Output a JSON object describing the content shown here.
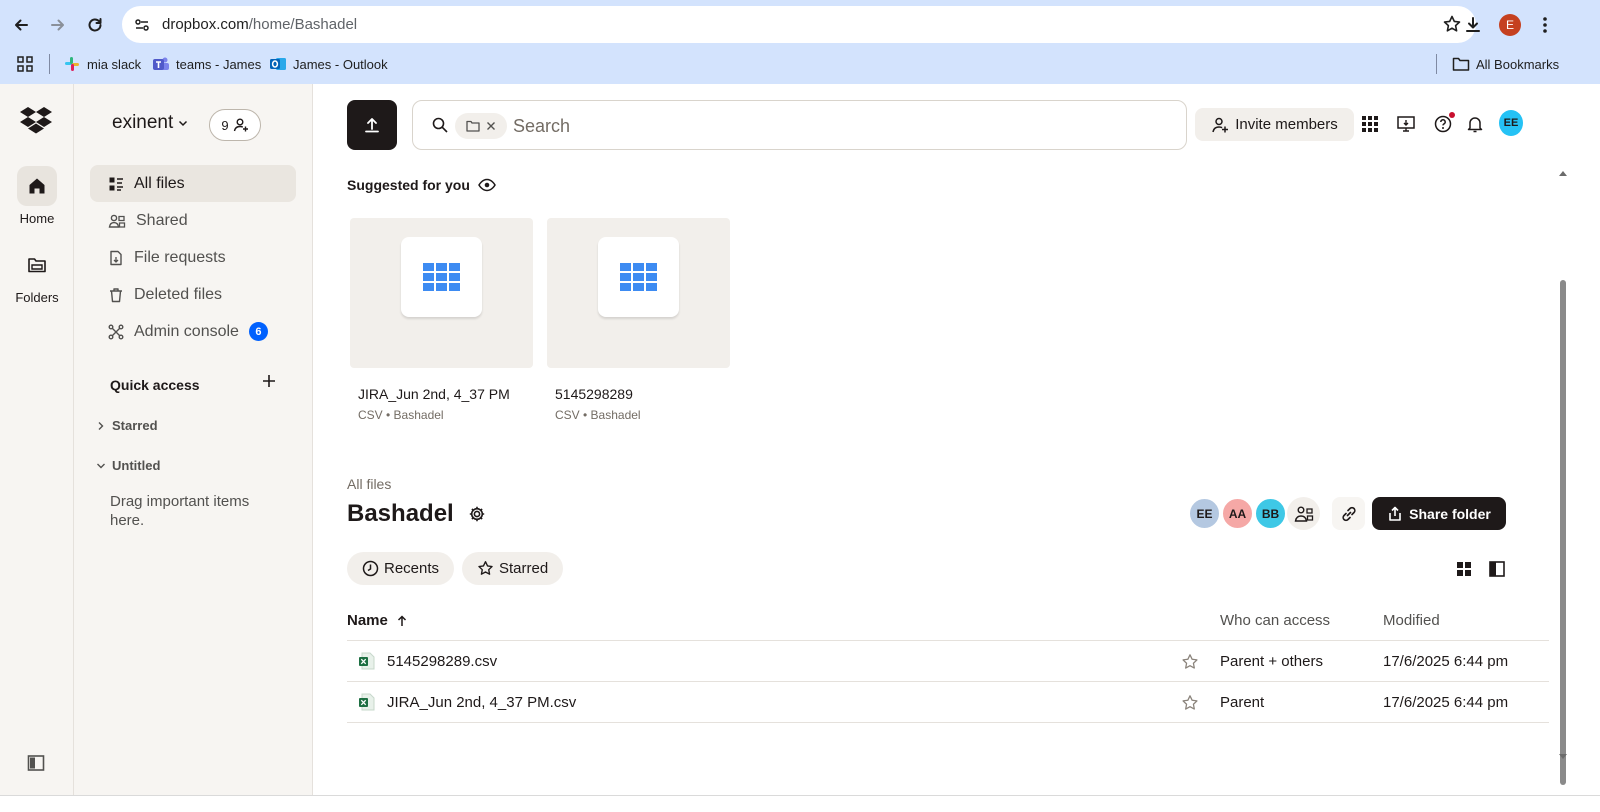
{
  "browser": {
    "url_host": "dropbox.com",
    "url_path": "/home/Bashadel",
    "profile_initial": "E",
    "bookmarks": [
      {
        "label": "mia slack",
        "icon": "slack-icon"
      },
      {
        "label": "teams - James",
        "icon": "teams-icon"
      },
      {
        "label": "James - Outlook",
        "icon": "outlook-icon"
      }
    ],
    "all_bookmarks": "All Bookmarks"
  },
  "rail": {
    "items": [
      {
        "label": "Home",
        "icon": "home-icon",
        "active": true
      },
      {
        "label": "Folders",
        "icon": "folder-icon",
        "active": false
      }
    ]
  },
  "sidebar": {
    "team_name": "exinent",
    "member_count": "9",
    "nav": [
      {
        "label": "All files",
        "icon": "all-files-icon",
        "active": true
      },
      {
        "label": "Shared",
        "icon": "shared-icon"
      },
      {
        "label": "File requests",
        "icon": "file-request-icon"
      },
      {
        "label": "Deleted files",
        "icon": "trash-icon"
      },
      {
        "label": "Admin console",
        "icon": "admin-console-icon",
        "badge": "6"
      }
    ],
    "quick_access": {
      "title": "Quick access",
      "groups": [
        "Starred",
        "Untitled"
      ],
      "empty_text": "Drag important items here."
    }
  },
  "topbar": {
    "search_placeholder": "Search",
    "invite_label": "Invite members",
    "user_initials": "EE",
    "user_color": "#25c2f5"
  },
  "suggested": {
    "title": "Suggested for you",
    "cards": [
      {
        "name": "JIRA_Jun 2nd, 4_37 PM",
        "meta": "CSV • Bashadel"
      },
      {
        "name": "5145298289",
        "meta": "CSV • Bashadel"
      }
    ]
  },
  "folder": {
    "breadcrumb": "All files",
    "title": "Bashadel",
    "members": [
      {
        "initials": "EE",
        "color": "#b4c8e1"
      },
      {
        "initials": "AA",
        "color": "#f5a8a6"
      },
      {
        "initials": "BB",
        "color": "#3ec8e6"
      }
    ],
    "share_label": "Share folder",
    "filters": [
      "Recents",
      "Starred"
    ]
  },
  "table": {
    "columns": {
      "name": "Name",
      "access": "Who can access",
      "modified": "Modified"
    },
    "rows": [
      {
        "name": "5145298289.csv",
        "access": "Parent + others",
        "modified": "17/6/2025 6:44 pm"
      },
      {
        "name": "JIRA_Jun 2nd, 4_37 PM.csv",
        "access": "Parent",
        "modified": "17/6/2025 6:44 pm"
      }
    ]
  },
  "colors": {
    "brand_dark": "#1e1919",
    "accent_blue": "#0061fe",
    "csv_green": "#1d6f42",
    "grid_blue": "#3d8bf2"
  }
}
